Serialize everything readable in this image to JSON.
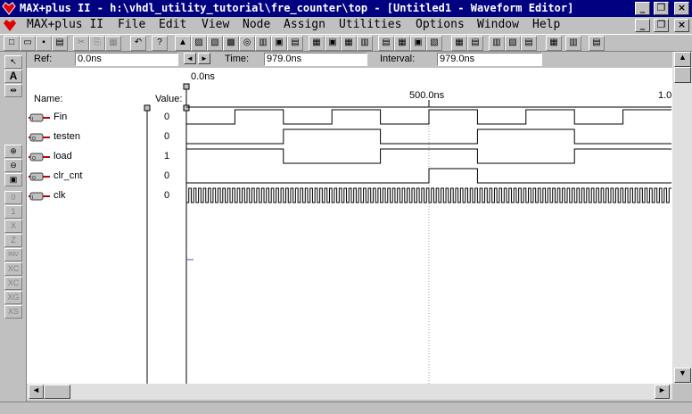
{
  "window": {
    "title": "MAX+plus II - h:\\vhdl_utility_tutorial\\fre_counter\\top - [Untitled1 - Waveform Editor]"
  },
  "menu": {
    "items": [
      "MAX+plus II",
      "File",
      "Edit",
      "View",
      "Node",
      "Assign",
      "Utilities",
      "Options",
      "Window",
      "Help"
    ]
  },
  "toolbar": {
    "icons": [
      "new-file",
      "open-file",
      "save",
      "print",
      "cut",
      "copy",
      "paste",
      "undo",
      "context-help",
      "compiler",
      "simulator",
      "timing-analyzer",
      "programmer",
      "hierarchy",
      "floorplan",
      "open-editor",
      "node-find",
      "hierarchy-up",
      "search-node",
      "report",
      "message",
      "timing",
      "simulation",
      "group",
      "ungroup",
      "zoom-fit"
    ]
  },
  "ref_bar": {
    "ref_label": "Ref:",
    "ref_value": "0.0ns",
    "time_label": "Time:",
    "time_value": "979.0ns",
    "interval_label": "Interval:",
    "interval_value": "979.0ns",
    "prev_arrow": "◄",
    "next_arrow": "►"
  },
  "timeline": {
    "origin_label": "0.0ns",
    "mark_500": "500.0ns",
    "mark_1000": "1.0",
    "time_span_ns": 1000
  },
  "columns": {
    "name_header": "Name:",
    "value_header": "Value:"
  },
  "signals": [
    {
      "name": "Fin",
      "value": "0",
      "type": "input",
      "transitions_ns": [
        0,
        100,
        200,
        300,
        400,
        500,
        600,
        700,
        800,
        900,
        1000
      ],
      "start_level": 0
    },
    {
      "name": "testen",
      "value": "0",
      "type": "output",
      "transitions_ns": [
        0,
        200,
        400,
        600,
        800,
        1000
      ],
      "start_level": 0
    },
    {
      "name": "load",
      "value": "1",
      "type": "output",
      "transitions_ns": [
        0,
        200,
        400,
        600,
        800,
        1000
      ],
      "start_level": 1
    },
    {
      "name": "clr_cnt",
      "value": "0",
      "type": "output",
      "transitions_ns": [
        0,
        500,
        600,
        1000
      ],
      "start_level": 0
    },
    {
      "name": "clk",
      "value": "0",
      "type": "input",
      "clock_period_ns": 5,
      "start_level": 0
    }
  ],
  "left_tools": {
    "items": [
      "pointer",
      "text",
      "node-align",
      "zoom-in",
      "zoom-out",
      "fit",
      "0",
      "1",
      "X",
      "Z",
      "INV",
      "OVERWRITE-CLOCK",
      "OVERWRITE-COUNT",
      "GROUP",
      "SEQUENCE"
    ]
  },
  "colors": {
    "title_bg": "#000080",
    "wave": "#000000",
    "grid_dot": "#c0c0c0",
    "input_pin": "#c00000"
  }
}
